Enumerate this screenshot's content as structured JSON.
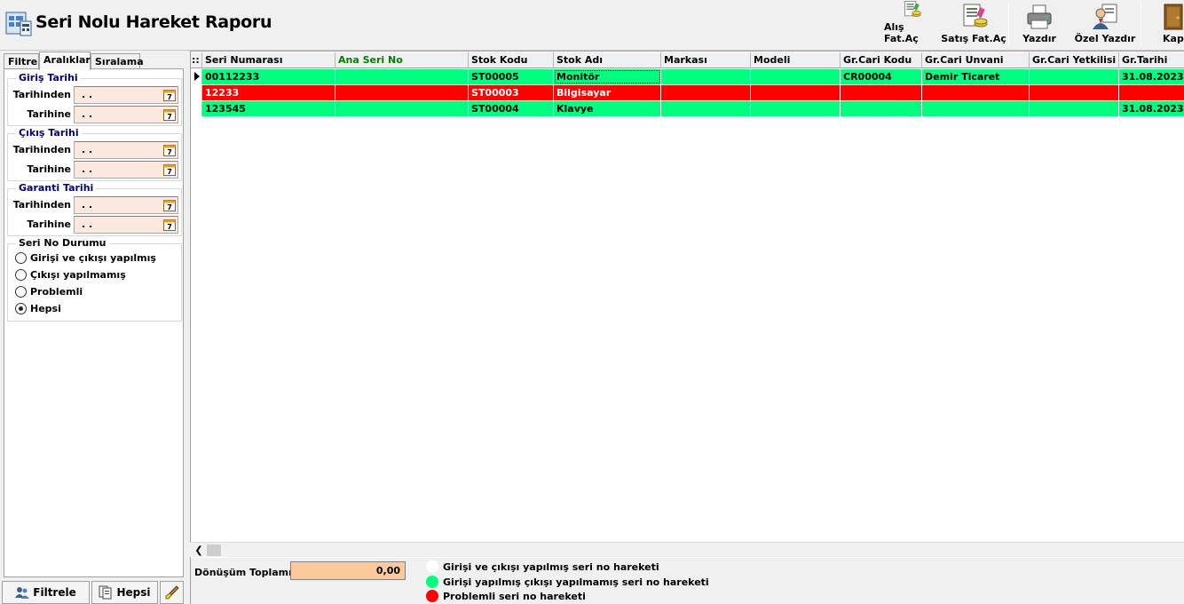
{
  "window": {
    "title": "Seri Nolu Hareket Raporu"
  },
  "toolbar": {
    "buttons": [
      {
        "label": "Alış Fat.Aç"
      },
      {
        "label": "Satış Fat.Aç"
      },
      {
        "label": "Yazdır"
      },
      {
        "label": "Özel Yazdır"
      },
      {
        "label": "Kapa"
      }
    ]
  },
  "left": {
    "tabs": [
      {
        "label": "Filtre"
      },
      {
        "label": "Aralıklar"
      },
      {
        "label": "Sıralama"
      }
    ],
    "groups": {
      "giris": {
        "title": "Giriş Tarihi",
        "from_label": "Tarihinden",
        "from_value": " . .",
        "to_label": "Tarihine",
        "to_value": " . ."
      },
      "cikis": {
        "title": "Çıkış Tarihi",
        "from_label": "Tarihinden",
        "from_value": " . .",
        "to_label": "Tarihine",
        "to_value": " . ."
      },
      "garanti": {
        "title": "Garanti Tarihi",
        "from_label": "Tarihinden",
        "from_value": " . .",
        "to_label": "Tarihine",
        "to_value": " . ."
      }
    },
    "seri_durum": {
      "title": "Seri No Durumu",
      "options": [
        {
          "label": "Girişi ve çıkışı yapılmış",
          "selected": false
        },
        {
          "label": "Çıkışı yapılmamış",
          "selected": false
        },
        {
          "label": "Problemli",
          "selected": false
        },
        {
          "label": "Hepsi",
          "selected": true
        }
      ]
    },
    "footer": {
      "filter_label": "Filtrele",
      "all_label": "Hepsi"
    }
  },
  "grid": {
    "indicator_header": "::",
    "columns": [
      "Seri Numarası",
      "Ana Seri No",
      "Stok Kodu",
      "Stok Adı",
      "Markası",
      "Modeli",
      "Gr.Cari Kodu",
      "Gr.Cari Unvani",
      "Gr.Cari Yetkilisi",
      "Gr.Tarihi"
    ],
    "rows": [
      {
        "status": "not-exited",
        "cells": [
          "00112233",
          "",
          "ST00005",
          "Monitör",
          "",
          "",
          "CR00004",
          "Demir Ticaret",
          "",
          "31.08.2023"
        ]
      },
      {
        "status": "problem",
        "cells": [
          "12233",
          "",
          "ST00003",
          "Bilgisayar",
          "",
          "",
          "",
          "",
          "",
          ""
        ]
      },
      {
        "status": "not-exited",
        "cells": [
          "123545",
          "",
          "ST00004",
          "Klavye",
          "",
          "",
          "",
          "",
          "",
          "31.08.2023"
        ]
      }
    ]
  },
  "bottom": {
    "total_label": "Dönüşüm Toplamı",
    "total_value": "0,00",
    "legend": [
      {
        "label": "Girişi ve çıkışı yapılmış seri no hareketi",
        "color": "#ffffff"
      },
      {
        "label": "Girişi yapılmış çıkışı yapılmamış seri no hareketi",
        "color": "#00ff80"
      },
      {
        "label": "Problemli seri no hareketi",
        "color": "#ff0000"
      }
    ]
  },
  "colors": {
    "row_green": "#00ff80",
    "row_red": "#ff0000",
    "date_bg": "#fbe9df",
    "total_bg": "#fcc99c",
    "group_title": "#000080",
    "header_green": "#008000"
  }
}
